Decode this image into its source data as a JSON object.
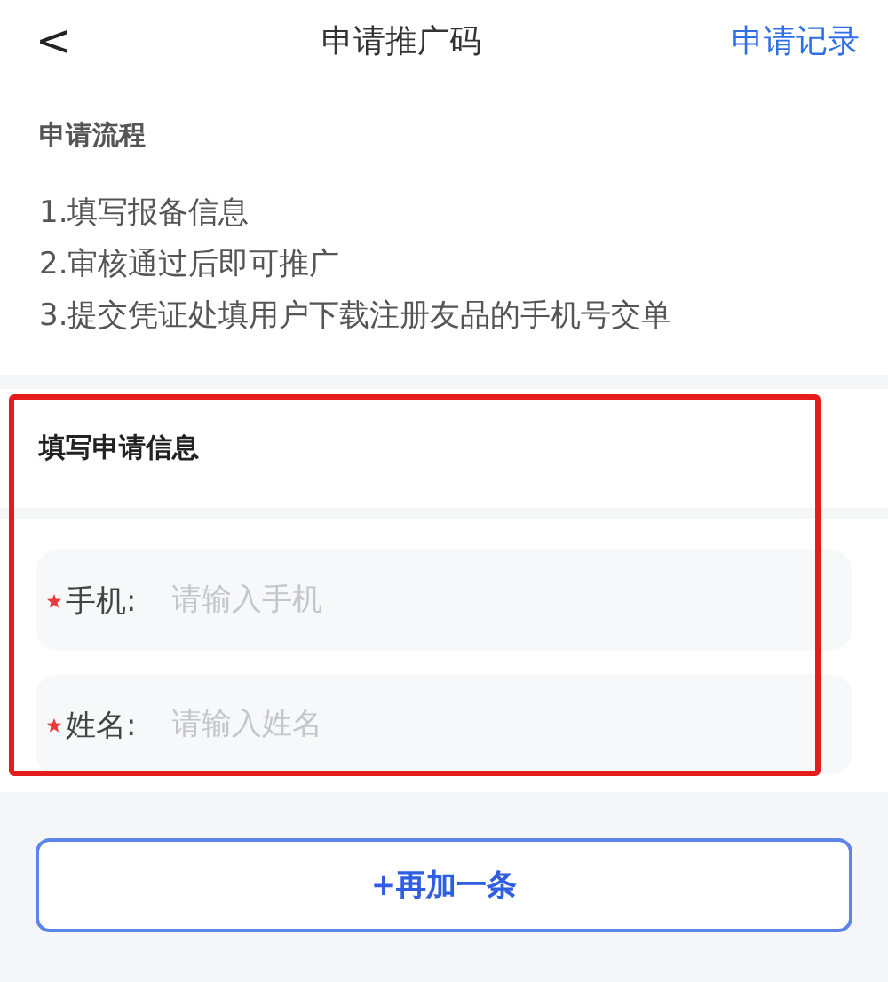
{
  "header": {
    "back": "<",
    "title": "申请推广码",
    "action": "申请记录"
  },
  "process": {
    "title": "申请流程",
    "steps": [
      "1.填写报备信息",
      "2.审核通过后即可推广",
      "3.提交凭证处填用户下载注册友品的手机号交单"
    ]
  },
  "form": {
    "title": "填写申请信息",
    "fields": [
      {
        "label": "手机:",
        "placeholder": "请输入手机",
        "required": true
      },
      {
        "label": "姓名:",
        "placeholder": "请输入姓名",
        "required": true
      }
    ]
  },
  "add_button": "+再加一条"
}
